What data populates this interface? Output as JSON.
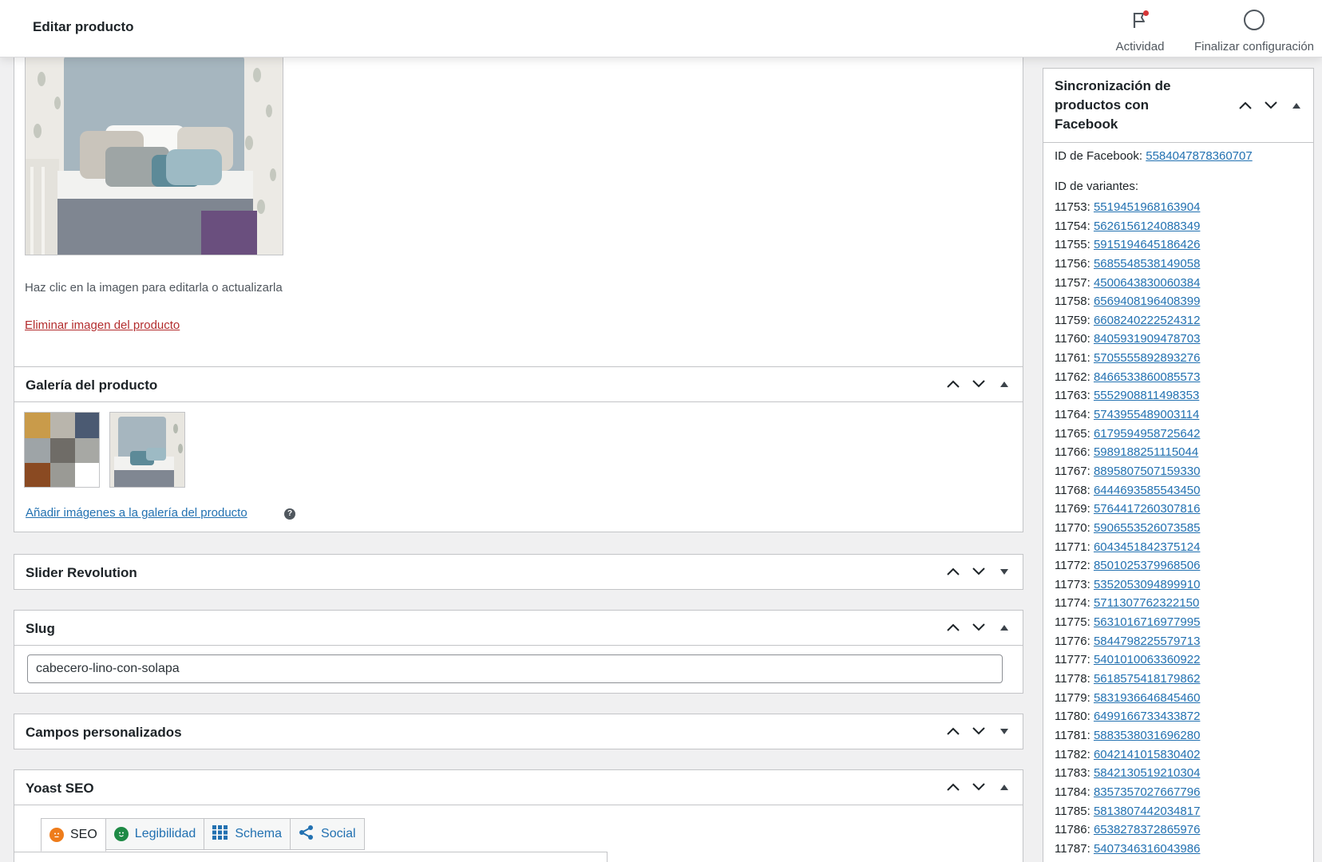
{
  "header": {
    "title": "Editar producto",
    "activity_label": "Actividad",
    "finish_label": "Finalizar configuración"
  },
  "image_box": {
    "hint": "Haz clic en la imagen para editarla o actualizarla",
    "remove_link": "Eliminar imagen del producto"
  },
  "gallery": {
    "title": "Galería del producto",
    "add_link": "Añadir imágenes a la galería del producto",
    "help": "?"
  },
  "slider": {
    "title": "Slider Revolution"
  },
  "slug": {
    "title": "Slug",
    "value": "cabecero-lino-con-solapa"
  },
  "custom_fields": {
    "title": "Campos personalizados"
  },
  "yoast": {
    "title": "Yoast SEO",
    "tabs": [
      {
        "label": "SEO",
        "icon": "face-orange-icon"
      },
      {
        "label": "Legibilidad",
        "icon": "face-green-icon"
      },
      {
        "label": "Schema",
        "icon": "grid-icon"
      },
      {
        "label": "Social",
        "icon": "share-icon"
      }
    ]
  },
  "facebook": {
    "title": "Sincronización de productos con Facebook",
    "id_label": "ID de Facebook: ",
    "id_value": "5584047878360707",
    "variants_label": "ID de variantes:",
    "variants": [
      {
        "k": "11753: ",
        "v": "5519451968163904"
      },
      {
        "k": "11754: ",
        "v": "5626156124088349"
      },
      {
        "k": "11755: ",
        "v": "5915194645186426"
      },
      {
        "k": "11756: ",
        "v": "5685548538149058"
      },
      {
        "k": "11757: ",
        "v": "4500643830060384"
      },
      {
        "k": "11758: ",
        "v": "6569408196408399"
      },
      {
        "k": "11759: ",
        "v": "6608240222524312"
      },
      {
        "k": "11760: ",
        "v": "8405931909478703"
      },
      {
        "k": "11761: ",
        "v": "5705555892893276"
      },
      {
        "k": "11762: ",
        "v": "8466533860085573"
      },
      {
        "k": "11763: ",
        "v": "5552908811498353"
      },
      {
        "k": "11764: ",
        "v": "5743955489003114"
      },
      {
        "k": "11765: ",
        "v": "6179594958725642"
      },
      {
        "k": "11766: ",
        "v": "5989188251115044"
      },
      {
        "k": "11767: ",
        "v": "8895807507159330"
      },
      {
        "k": "11768: ",
        "v": "6444693585543450"
      },
      {
        "k": "11769: ",
        "v": "5764417260307816"
      },
      {
        "k": "11770: ",
        "v": "5906553526073585"
      },
      {
        "k": "11771: ",
        "v": "6043451842375124"
      },
      {
        "k": "11772: ",
        "v": "8501025379968506"
      },
      {
        "k": "11773: ",
        "v": "5352053094899910"
      },
      {
        "k": "11774: ",
        "v": "5711307762322150"
      },
      {
        "k": "11775: ",
        "v": "5631016716977995"
      },
      {
        "k": "11776: ",
        "v": "5844798225579713"
      },
      {
        "k": "11777: ",
        "v": "5401010063360922"
      },
      {
        "k": "11778: ",
        "v": "5618575418179862"
      },
      {
        "k": "11779: ",
        "v": "5831936646845460"
      },
      {
        "k": "11780: ",
        "v": "6499166733433872"
      },
      {
        "k": "11781: ",
        "v": "5883538031696280"
      },
      {
        "k": "11782: ",
        "v": "6042141015830402"
      },
      {
        "k": "11783: ",
        "v": "5842130519210304"
      },
      {
        "k": "11784: ",
        "v": "8357357027667796"
      },
      {
        "k": "11785: ",
        "v": "5813807442034817"
      },
      {
        "k": "11786: ",
        "v": "6538278372865976"
      },
      {
        "k": "11787: ",
        "v": "5407346316043986"
      }
    ]
  },
  "colors": {
    "link": "#2271b1",
    "danger": "#b32d2e",
    "border": "#c3c4c7",
    "notice_dot": "#d63638"
  }
}
